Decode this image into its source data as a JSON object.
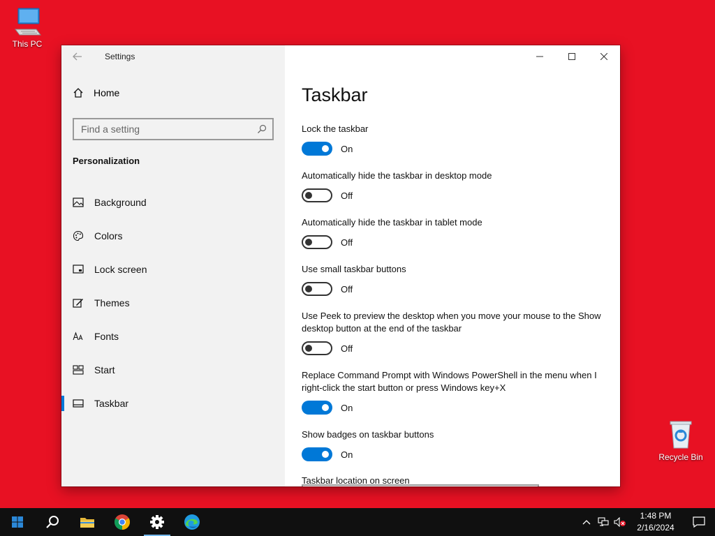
{
  "desktop": {
    "icons": [
      {
        "label": "This PC"
      },
      {
        "label": "Recycle Bin"
      }
    ]
  },
  "window": {
    "app_title": "Settings",
    "sidebar": {
      "home_label": "Home",
      "search_placeholder": "Find a setting",
      "section": "Personalization",
      "items": [
        {
          "label": "Background",
          "icon": "image-icon"
        },
        {
          "label": "Colors",
          "icon": "palette-icon"
        },
        {
          "label": "Lock screen",
          "icon": "lock-screen-icon"
        },
        {
          "label": "Themes",
          "icon": "themes-icon"
        },
        {
          "label": "Fonts",
          "icon": "fonts-icon"
        },
        {
          "label": "Start",
          "icon": "start-icon"
        },
        {
          "label": "Taskbar",
          "icon": "taskbar-icon",
          "active": true
        }
      ]
    },
    "content": {
      "title": "Taskbar",
      "settings": [
        {
          "label": "Lock the taskbar",
          "state": "On"
        },
        {
          "label": "Automatically hide the taskbar in desktop mode",
          "state": "Off"
        },
        {
          "label": "Automatically hide the taskbar in tablet mode",
          "state": "Off"
        },
        {
          "label": "Use small taskbar buttons",
          "state": "Off"
        },
        {
          "label": "Use Peek to preview the desktop when you move your mouse to the Show desktop button at the end of the taskbar",
          "state": "Off"
        },
        {
          "label": "Replace Command Prompt with Windows PowerShell in the menu when I right-click the start button or press Windows key+X",
          "state": "On"
        },
        {
          "label": "Show badges on taskbar buttons",
          "state": "On"
        }
      ],
      "location_label": "Taskbar location on screen"
    }
  },
  "taskbar": {
    "apps": [
      "start-icon",
      "search-icon",
      "file-explorer-icon",
      "chrome-icon",
      "settings-icon",
      "edge-icon"
    ],
    "clock": {
      "time": "1:48 PM",
      "date": "2/16/2024"
    }
  },
  "colors": {
    "desktop": "#e81123",
    "accent": "#0078d7",
    "taskbar": "#101010"
  }
}
